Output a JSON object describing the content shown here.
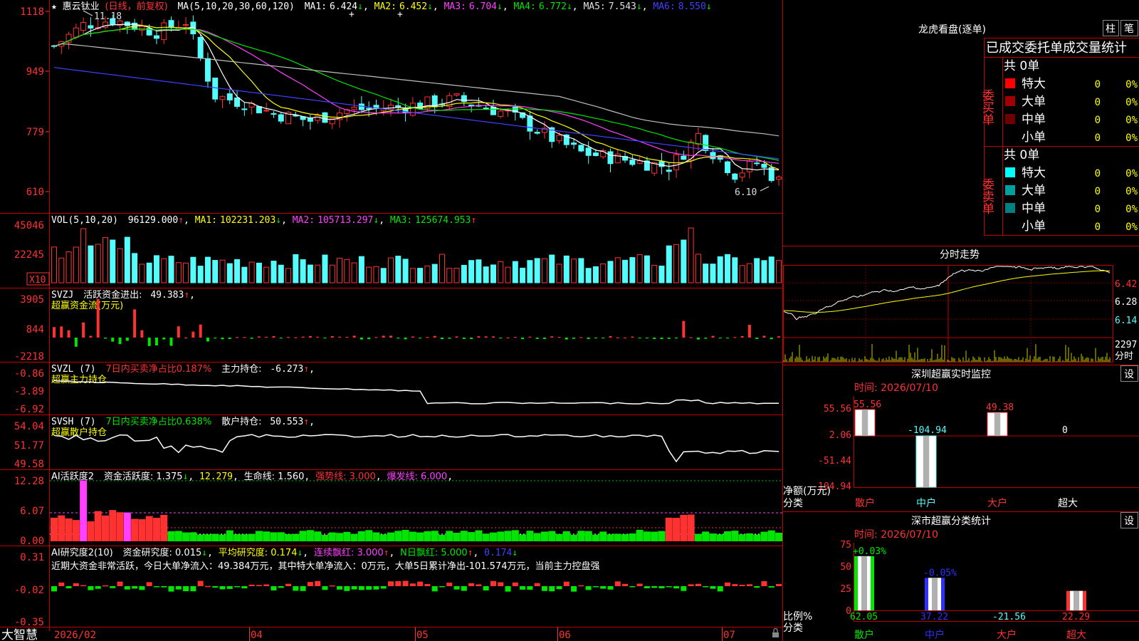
{
  "colors": {
    "up": "#ff3232",
    "down": "#54fcfc",
    "green": "#00e600",
    "ma1": "#ffffff",
    "ma2": "#ffff00",
    "ma3": "#ff40ff",
    "ma4": "#00e600",
    "ma5": "#c0c0c0",
    "ma6": "#4040ff",
    "axis": "#ff3232",
    "grid": "#7a0000"
  },
  "icons": {
    "star": "star-icon",
    "lock": "lock-icon"
  },
  "app": {
    "name": "大智慧"
  },
  "main": {
    "stock_name": "惠云钛业",
    "period": "(日线，前复权)",
    "ma_header": "MA(5,10,20,30,60,120)",
    "ma": [
      {
        "label": "MA1:",
        "value": "6.424",
        "arrow": "↓"
      },
      {
        "label": "MA2:",
        "value": "6.452",
        "arrow": "↓"
      },
      {
        "label": "MA3:",
        "value": "6.704",
        "arrow": "↓"
      },
      {
        "label": "MA4:",
        "value": "6.772",
        "arrow": "↓"
      },
      {
        "label": "MA5:",
        "value": "7.543",
        "arrow": "↓"
      },
      {
        "label": "MA6:",
        "value": "8.550",
        "arrow": "↓"
      }
    ],
    "price_axis": [
      "1118",
      "949",
      "779",
      "610"
    ],
    "high_label": "11.18",
    "low_label": "6.10"
  },
  "vol": {
    "header": "VOL(5,10,20)",
    "value": "96129.000",
    "arrow": "↑",
    "ma": [
      {
        "label": "MA1:",
        "value": "102231.203",
        "arrow": "↓"
      },
      {
        "label": "MA2:",
        "value": "105713.297",
        "arrow": "↓"
      },
      {
        "label": "MA3:",
        "value": "125674.953",
        "arrow": "↑"
      }
    ],
    "axis": [
      "45046",
      "22245"
    ],
    "unit": "X10"
  },
  "svzj": {
    "header": "SVZJ",
    "label": "活跃资金进出:",
    "value": "49.383",
    "arrow": "↑",
    "suffix": ",",
    "title": "超赢资金流(万元)",
    "axis": [
      "3905",
      "844",
      "-2218"
    ]
  },
  "svzl": {
    "header": "SVZL (7)",
    "net": "7日内买卖净占比0.187%",
    "label": "主力持仓:",
    "value": "-6.273",
    "arrow": "↑",
    "suffix": ",",
    "title": "超赢主力持仓",
    "axis": [
      "-0.86",
      "-3.89",
      "-6.92"
    ]
  },
  "svsh": {
    "header": "SVSH (7)",
    "net": "7日内买卖净占比0.638%",
    "label": "散户持仓:",
    "value": "50.553",
    "arrow": "↑",
    "suffix": ",",
    "title": "超赢散户持仓",
    "axis": [
      "54.04",
      "51.77",
      "49.58"
    ]
  },
  "ai_active": {
    "header": "AI活跃度2",
    "items": [
      {
        "text": "资金活跃度: 1.375",
        "arrow": "↓",
        "suffix": ","
      },
      {
        "text": "12.279",
        "arrow": "",
        "suffix": ","
      },
      {
        "text": "生命线: 1.560",
        "arrow": "",
        "suffix": ","
      },
      {
        "text": "强势线: 3.000",
        "arrow": "",
        "suffix": ","
      },
      {
        "text": "爆发线: 6.000",
        "arrow": "",
        "suffix": ","
      }
    ],
    "axis": [
      "12.28",
      "6.07",
      "0.00"
    ]
  },
  "ai_research": {
    "header": "AI研究度2(10)",
    "items": [
      {
        "text": "资金研究度: 0.015",
        "arrow": "↓",
        "suffix": ","
      },
      {
        "text": "平均研究度: 0.174",
        "arrow": "↓",
        "suffix": ","
      },
      {
        "text": "连续飘红: 3.000",
        "arrow": "↑",
        "suffix": ","
      },
      {
        "text": "N日飘红: 5.000",
        "arrow": "↑",
        "suffix": ","
      },
      {
        "text": "0.174",
        "arrow": "↓",
        "suffix": ""
      }
    ],
    "comment": "近期大资金非常活跃，今日大单净流入：49.384万元，其中特大单净流入：0万元，大单5日累计净出-101.574万元，当前主力控盘强",
    "axis": [
      "0.31",
      "-0.02",
      "-0.35"
    ]
  },
  "dates": [
    "2026/02",
    "04",
    "05",
    "06",
    "07"
  ],
  "longhu": {
    "title": "龙虎看盘(逐单)",
    "btn1": "柱",
    "btn2": "笔",
    "subtitle": "已成交委托单成交量统计",
    "buy_label": "委买单",
    "sell_label": "委卖单",
    "buy_total": "共 0单",
    "sell_total": "共 0单",
    "buy_rows": [
      {
        "name": "特大",
        "count": "0",
        "pct": "0%",
        "color": "#ff0000"
      },
      {
        "name": "大单",
        "count": "0",
        "pct": "0%",
        "color": "#a00000"
      },
      {
        "name": "中单",
        "count": "0",
        "pct": "0%",
        "color": "#700000"
      },
      {
        "name": "小单",
        "count": "0",
        "pct": "0%",
        "color": ""
      }
    ],
    "sell_rows": [
      {
        "name": "特大",
        "count": "0",
        "pct": "0%",
        "color": "#00ffff"
      },
      {
        "name": "大单",
        "count": "0",
        "pct": "0%",
        "color": "#00a0a0"
      },
      {
        "name": "中单",
        "count": "0",
        "pct": "0%",
        "color": "#008080"
      },
      {
        "name": "小单",
        "count": "0",
        "pct": "0%",
        "color": ""
      }
    ]
  },
  "intraday": {
    "title": "分时走势",
    "price_axis": [
      "6.42",
      "6.28",
      "6.14"
    ],
    "vol_axis": "2297",
    "vol_label": "分时"
  },
  "sz_monitor": {
    "title": "深圳超赢实时监控",
    "set_btn": "设",
    "time": "时间: 2026/07/10",
    "y_axis": [
      "55.56",
      "2.06",
      "-51.44",
      "-104.94"
    ],
    "y_label": "净额(万元)",
    "x_label": "分类",
    "bars": [
      {
        "cat": "散户",
        "value": 55.56,
        "label": "55.56"
      },
      {
        "cat": "中户",
        "value": -104.94,
        "label": "-104.94"
      },
      {
        "cat": "大户",
        "value": 49.38,
        "label": "49.38"
      },
      {
        "cat": "超大",
        "value": 0,
        "label": "0"
      }
    ]
  },
  "sz_class": {
    "title": "深市超赢分类统计",
    "set_btn": "设",
    "time": "时间: 2026/07/10",
    "y_axis": [
      "75",
      "50",
      "25",
      "0"
    ],
    "y_label": "比例%",
    "x_label": "分类",
    "bars": [
      {
        "cat": "散户",
        "value": 62.05,
        "label": "62.05",
        "change": "+0.03%"
      },
      {
        "cat": "中户",
        "value": 37.22,
        "label": "37.22",
        "change": "-0.05%"
      },
      {
        "cat": "大户",
        "value": -21.56,
        "label": "-21.56",
        "change": ""
      },
      {
        "cat": "超大",
        "value": 22.29,
        "label": "22.29",
        "change": ""
      }
    ]
  }
}
